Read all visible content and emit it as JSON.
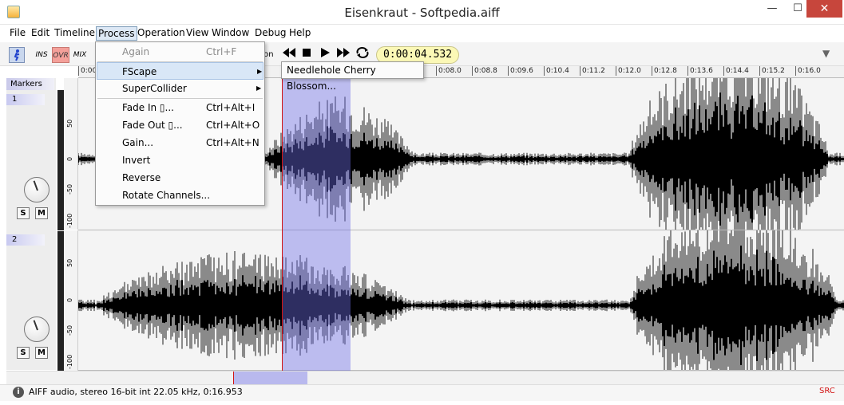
{
  "window": {
    "title": "Eisenkraut - Softpedia.aiff",
    "min_glyph": "—",
    "max_glyph": "☐",
    "close_glyph": "✕"
  },
  "menubar": [
    "File",
    "Edit",
    "Timeline",
    "Process",
    "Operation",
    "View",
    "Window",
    "Debug",
    "Help"
  ],
  "toolbar": {
    "ins_label": "INS",
    "ovr_label": "OVR",
    "mix_label": "MIX",
    "position_label": "ion",
    "timecode": "0:00:04.532"
  },
  "ruler": [
    "0:00",
    "0:08.0",
    "0:08.8",
    "0:09.6",
    "0:10.4",
    "0:11.2",
    "0:12.0",
    "0:12.8",
    "0:13.6",
    "0:14.4",
    "0:15.2",
    "0:16.0"
  ],
  "markers_tab": "Markers",
  "tracks": [
    {
      "label": "1",
      "amp_labels": [
        "50",
        "0",
        "-50",
        "-100"
      ],
      "solo": "S",
      "mute": "M"
    },
    {
      "label": "2",
      "amp_labels": [
        "50",
        "0",
        "-50",
        "-100"
      ],
      "solo": "S",
      "mute": "M"
    }
  ],
  "process_menu": {
    "items": [
      {
        "label": "Again",
        "shortcut": "Ctrl+F"
      },
      {
        "label": "FScape",
        "shortcut": ""
      },
      {
        "label": "SuperCollider",
        "shortcut": ""
      },
      {
        "label": "Fade In ▯...",
        "shortcut": "Ctrl+Alt+I"
      },
      {
        "label": "Fade Out ▯...",
        "shortcut": "Ctrl+Alt+O"
      },
      {
        "label": "Gain...",
        "shortcut": "Ctrl+Alt+N"
      },
      {
        "label": "Invert",
        "shortcut": ""
      },
      {
        "label": "Reverse",
        "shortcut": ""
      },
      {
        "label": "Rotate Channels...",
        "shortcut": ""
      }
    ],
    "fscape_submenu": [
      "Needlehole Cherry Blossom..."
    ]
  },
  "status": {
    "text": "AIFF audio, stereo 16-bit int 22.05 kHz, 0:16.953",
    "src": "SRC"
  },
  "colors": {
    "selection": "#6e6ee6",
    "cursor": "#d21414",
    "waveform_light": "#8a8a8a",
    "waveform_dark": "#000000"
  }
}
